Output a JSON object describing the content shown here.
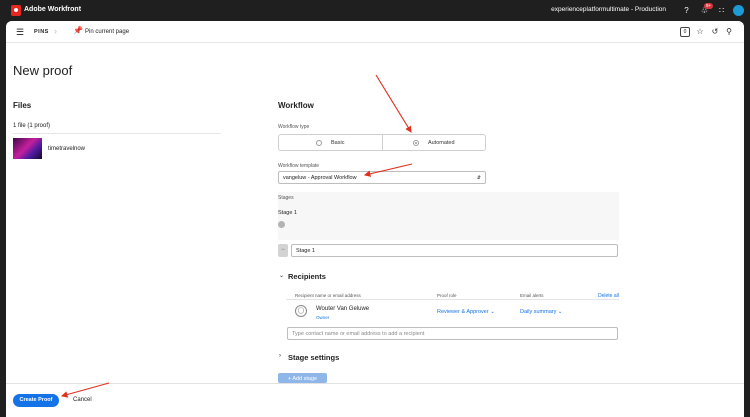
{
  "topbar": {
    "app_title": "Adobe Workfront",
    "org": "experienceplatformultimate - Production",
    "notification_count": "9+"
  },
  "subbar": {
    "pins_label": "PINS",
    "pin_page_label": "Pin current page"
  },
  "page": {
    "title": "New proof"
  },
  "files": {
    "heading": "Files",
    "count": "1 file (1 proof)",
    "items": [
      {
        "name": "timetravelnow"
      }
    ]
  },
  "workflow": {
    "heading": "Workflow",
    "type_label": "Workflow type",
    "type_options": [
      "Basic",
      "Automated"
    ],
    "selected_type": "Automated",
    "template_label": "Workflow template",
    "template_value": "vangeluw - Approval Workflow",
    "stages_label": "Stages",
    "stage_names": [
      "Stage 1"
    ],
    "stage_input_value": "Stage 1"
  },
  "recipients": {
    "heading": "Recipients",
    "col_name": "Recipient name or email address",
    "col_role": "Proof role",
    "col_alerts": "Email alerts",
    "delete_all": "Delete all",
    "rows": [
      {
        "name": "Wouter Van Geluwe",
        "role_tag": "Owner",
        "proof_role": "Reviewer & Approver",
        "alerts": "Daily summary"
      }
    ],
    "contact_placeholder": "Type contact name or email address to add a recipient"
  },
  "stage_settings": {
    "heading": "Stage settings"
  },
  "add_stage": {
    "label": "+ Add stage"
  },
  "footer": {
    "create": "Create Proof",
    "cancel": "Cancel"
  },
  "colors": {
    "accent": "#1473e6",
    "annotation_arrow": "#e0301e",
    "topbar": "#1f1f1f"
  }
}
